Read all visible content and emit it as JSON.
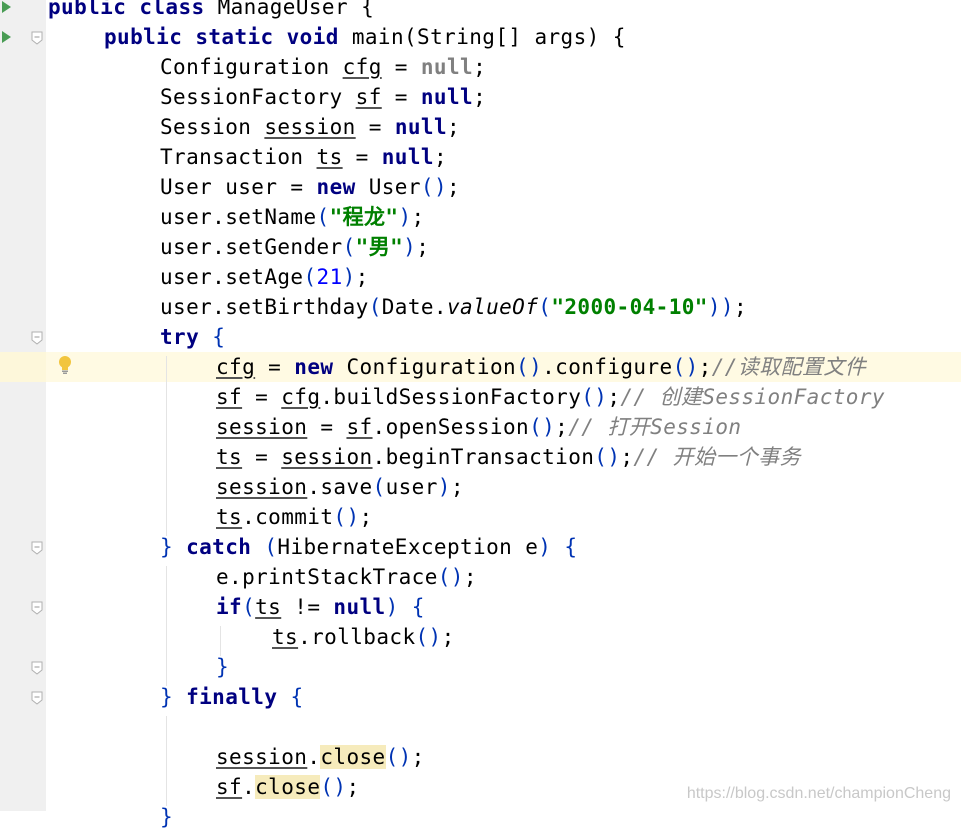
{
  "editor": {
    "lines": [
      {
        "indent": 0,
        "tokens": [
          {
            "t": "public ",
            "c": "kw"
          },
          {
            "t": "class ",
            "c": "kw"
          },
          {
            "t": "ManageUser ",
            "c": ""
          },
          {
            "t": "{",
            "c": ""
          }
        ]
      },
      {
        "indent": 1,
        "tokens": [
          {
            "t": "public ",
            "c": "kw"
          },
          {
            "t": "static ",
            "c": "kw"
          },
          {
            "t": "void ",
            "c": "kw"
          },
          {
            "t": "main(String[] args) ",
            "c": ""
          },
          {
            "t": "{",
            "c": ""
          }
        ]
      },
      {
        "indent": 2,
        "tokens": [
          {
            "t": "Configuration ",
            "c": ""
          },
          {
            "t": "cfg",
            "c": "var"
          },
          {
            "t": " = ",
            "c": ""
          },
          {
            "t": "null",
            "c": "nullg"
          },
          {
            "t": ";",
            "c": ""
          }
        ]
      },
      {
        "indent": 2,
        "tokens": [
          {
            "t": "SessionFactory ",
            "c": ""
          },
          {
            "t": "sf",
            "c": "var"
          },
          {
            "t": " = ",
            "c": ""
          },
          {
            "t": "null",
            "c": "kw"
          },
          {
            "t": ";",
            "c": ""
          }
        ]
      },
      {
        "indent": 2,
        "tokens": [
          {
            "t": "Session ",
            "c": ""
          },
          {
            "t": "session",
            "c": "var"
          },
          {
            "t": " = ",
            "c": ""
          },
          {
            "t": "null",
            "c": "kw"
          },
          {
            "t": ";",
            "c": ""
          }
        ]
      },
      {
        "indent": 2,
        "tokens": [
          {
            "t": "Transaction ",
            "c": ""
          },
          {
            "t": "ts",
            "c": "var"
          },
          {
            "t": " = ",
            "c": ""
          },
          {
            "t": "null",
            "c": "kw"
          },
          {
            "t": ";",
            "c": ""
          }
        ]
      },
      {
        "indent": 2,
        "tokens": [
          {
            "t": "User user = ",
            "c": ""
          },
          {
            "t": "new ",
            "c": "kw"
          },
          {
            "t": "User",
            "c": ""
          },
          {
            "t": "()",
            "c": "brace"
          },
          {
            "t": ";",
            "c": ""
          }
        ]
      },
      {
        "indent": 2,
        "tokens": [
          {
            "t": "user.setName",
            "c": ""
          },
          {
            "t": "(",
            "c": "brace"
          },
          {
            "t": "\"程龙\"",
            "c": "str"
          },
          {
            "t": ")",
            "c": "brace"
          },
          {
            "t": ";",
            "c": ""
          }
        ]
      },
      {
        "indent": 2,
        "tokens": [
          {
            "t": "user.setGender",
            "c": ""
          },
          {
            "t": "(",
            "c": "brace"
          },
          {
            "t": "\"男\"",
            "c": "str"
          },
          {
            "t": ")",
            "c": "brace"
          },
          {
            "t": ";",
            "c": ""
          }
        ]
      },
      {
        "indent": 2,
        "tokens": [
          {
            "t": "user.setAge",
            "c": ""
          },
          {
            "t": "(",
            "c": "brace"
          },
          {
            "t": "21",
            "c": "num"
          },
          {
            "t": ")",
            "c": "brace"
          },
          {
            "t": ";",
            "c": ""
          }
        ]
      },
      {
        "indent": 2,
        "tokens": [
          {
            "t": "user.setBirthday",
            "c": ""
          },
          {
            "t": "(",
            "c": "brace"
          },
          {
            "t": "Date.",
            "c": ""
          },
          {
            "t": "valueOf",
            "c": "method-italic"
          },
          {
            "t": "(",
            "c": "brace"
          },
          {
            "t": "\"2000-04-10\"",
            "c": "str"
          },
          {
            "t": "))",
            "c": "brace"
          },
          {
            "t": ";",
            "c": ""
          }
        ]
      },
      {
        "indent": 2,
        "tokens": [
          {
            "t": "try ",
            "c": "kw"
          },
          {
            "t": "{",
            "c": "brace"
          }
        ]
      },
      {
        "indent": 3,
        "caret": true,
        "tokens": [
          {
            "t": "cfg",
            "c": "var"
          },
          {
            "t": " = ",
            "c": ""
          },
          {
            "t": "new ",
            "c": "kw"
          },
          {
            "t": "Configuration",
            "c": ""
          },
          {
            "t": "()",
            "c": "brace"
          },
          {
            "t": ".configure",
            "c": ""
          },
          {
            "t": "()",
            "c": "brace"
          },
          {
            "t": ";",
            "c": ""
          },
          {
            "t": "//读取配置文件",
            "c": "comment"
          }
        ]
      },
      {
        "indent": 3,
        "tokens": [
          {
            "t": "sf",
            "c": "var"
          },
          {
            "t": " = ",
            "c": ""
          },
          {
            "t": "cfg",
            "c": "var"
          },
          {
            "t": ".buildSessionFactory",
            "c": ""
          },
          {
            "t": "()",
            "c": "brace"
          },
          {
            "t": ";",
            "c": ""
          },
          {
            "t": "// 创建SessionFactory",
            "c": "comment"
          }
        ]
      },
      {
        "indent": 3,
        "tokens": [
          {
            "t": "session",
            "c": "var"
          },
          {
            "t": " = ",
            "c": ""
          },
          {
            "t": "sf",
            "c": "var"
          },
          {
            "t": ".openSession",
            "c": ""
          },
          {
            "t": "()",
            "c": "brace"
          },
          {
            "t": ";",
            "c": ""
          },
          {
            "t": "// 打开Session",
            "c": "comment"
          }
        ]
      },
      {
        "indent": 3,
        "tokens": [
          {
            "t": "ts",
            "c": "var"
          },
          {
            "t": " = ",
            "c": ""
          },
          {
            "t": "session",
            "c": "var"
          },
          {
            "t": ".beginTransaction",
            "c": ""
          },
          {
            "t": "()",
            "c": "brace"
          },
          {
            "t": ";",
            "c": ""
          },
          {
            "t": "// 开始一个事务",
            "c": "comment"
          }
        ]
      },
      {
        "indent": 3,
        "tokens": [
          {
            "t": "session",
            "c": "var"
          },
          {
            "t": ".save",
            "c": ""
          },
          {
            "t": "(",
            "c": "brace"
          },
          {
            "t": "user",
            "c": ""
          },
          {
            "t": ")",
            "c": "brace"
          },
          {
            "t": ";",
            "c": ""
          }
        ]
      },
      {
        "indent": 3,
        "tokens": [
          {
            "t": "ts",
            "c": "var"
          },
          {
            "t": ".commit",
            "c": ""
          },
          {
            "t": "()",
            "c": "brace"
          },
          {
            "t": ";",
            "c": ""
          }
        ]
      },
      {
        "indent": 2,
        "tokens": [
          {
            "t": "} ",
            "c": "brace"
          },
          {
            "t": "catch ",
            "c": "kw"
          },
          {
            "t": "(",
            "c": "brace"
          },
          {
            "t": "HibernateException e",
            "c": ""
          },
          {
            "t": ") {",
            "c": "brace"
          }
        ]
      },
      {
        "indent": 3,
        "tokens": [
          {
            "t": "e.printStackTrace",
            "c": ""
          },
          {
            "t": "()",
            "c": "brace"
          },
          {
            "t": ";",
            "c": ""
          }
        ]
      },
      {
        "indent": 3,
        "tokens": [
          {
            "t": "if",
            "c": "kw"
          },
          {
            "t": "(",
            "c": "brace"
          },
          {
            "t": "ts",
            "c": "var"
          },
          {
            "t": " != ",
            "c": ""
          },
          {
            "t": "null",
            "c": "kw"
          },
          {
            "t": ") {",
            "c": "brace"
          }
        ]
      },
      {
        "indent": 4,
        "tokens": [
          {
            "t": "ts",
            "c": "var"
          },
          {
            "t": ".rollback",
            "c": ""
          },
          {
            "t": "()",
            "c": "brace"
          },
          {
            "t": ";",
            "c": ""
          }
        ]
      },
      {
        "indent": 3,
        "tokens": [
          {
            "t": "}",
            "c": "brace"
          }
        ]
      },
      {
        "indent": 2,
        "tokens": [
          {
            "t": "} ",
            "c": "brace"
          },
          {
            "t": "finally ",
            "c": "kw"
          },
          {
            "t": "{",
            "c": "brace"
          }
        ]
      },
      {
        "indent": 3,
        "tokens": []
      },
      {
        "indent": 3,
        "tokens": [
          {
            "t": "session",
            "c": "var"
          },
          {
            "t": ".",
            "c": ""
          },
          {
            "t": "close",
            "c": "hl"
          },
          {
            "t": "()",
            "c": "brace"
          },
          {
            "t": ";",
            "c": ""
          }
        ]
      },
      {
        "indent": 3,
        "tokens": [
          {
            "t": "sf",
            "c": "var"
          },
          {
            "t": ".",
            "c": ""
          },
          {
            "t": "close",
            "c": "hl"
          },
          {
            "t": "()",
            "c": "brace"
          },
          {
            "t": ";",
            "c": ""
          }
        ]
      },
      {
        "indent": 2,
        "tokens": [
          {
            "t": "}",
            "c": "brace"
          }
        ]
      }
    ]
  },
  "gutter": {
    "run_icons": [
      0,
      1
    ],
    "fold_markers": [
      1,
      11,
      18,
      20,
      22,
      23
    ],
    "bulb_line": 12
  },
  "watermark": "https://blog.csdn.net/championCheng",
  "colors": {
    "keyword": "#000080",
    "string": "#008000",
    "number": "#0000ff",
    "comment": "#808080",
    "gutter_bg": "#f0f0f0",
    "caret_line_bg": "#fffae3",
    "run_icon": "#499c54",
    "bulb": "#f2c53d"
  }
}
